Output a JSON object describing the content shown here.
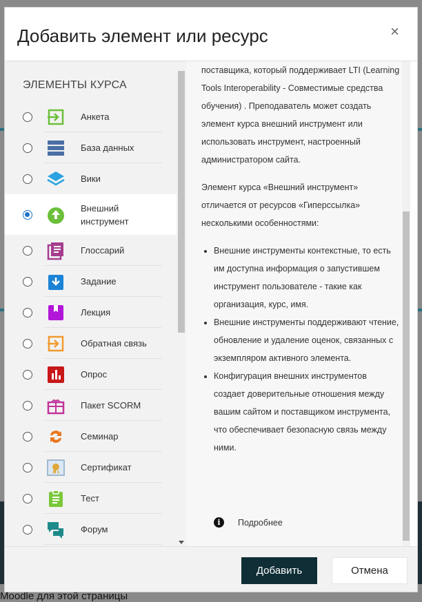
{
  "background": {
    "footer_text": "Moodle для этой страницы"
  },
  "modal": {
    "title": "Добавить элемент или ресурс",
    "close_symbol": "×",
    "section_heading": "ЭЛЕМЕНТЫ КУРСА",
    "items": [
      {
        "label": "Анкета",
        "icon": "feedback-arrow-icon",
        "color": "#6cbf3a",
        "selected": false
      },
      {
        "label": "База данных",
        "icon": "database-icon",
        "color": "#4a6fa5",
        "selected": false
      },
      {
        "label": "Вики",
        "icon": "wiki-layers-icon",
        "color": "#2ba3e0",
        "selected": false
      },
      {
        "label": "Внешний инструмент",
        "icon": "upload-cloud-icon",
        "color": "#6cbf3a",
        "selected": true
      },
      {
        "label": "Глоссарий",
        "icon": "glossary-icon",
        "color": "#a63d8f",
        "selected": false
      },
      {
        "label": "Задание",
        "icon": "assignment-icon",
        "color": "#1b83d6",
        "selected": false
      },
      {
        "label": "Лекция",
        "icon": "lesson-icon",
        "color": "#b117d8",
        "selected": false
      },
      {
        "label": "Обратная связь",
        "icon": "feedback-icon",
        "color": "#f29a2e",
        "selected": false
      },
      {
        "label": "Опрос",
        "icon": "choice-chart-icon",
        "color": "#c81818",
        "selected": false
      },
      {
        "label": "Пакет SCORM",
        "icon": "scorm-package-icon",
        "color": "#c2339a",
        "selected": false
      },
      {
        "label": "Семинар",
        "icon": "workshop-cycle-icon",
        "color": "#e9761d",
        "selected": false
      },
      {
        "label": "Сертификат",
        "icon": "certificate-icon",
        "color": "#e0a83a",
        "selected": false
      },
      {
        "label": "Тест",
        "icon": "quiz-icon",
        "color": "#7ac83a",
        "selected": false
      },
      {
        "label": "Форум",
        "icon": "forum-icon",
        "color": "#1f8a8a",
        "selected": false
      }
    ],
    "description": {
      "intro": "поставщика, который поддерживает LTI (Learning Tools Interoperability - Совместимые средства обучения) . Преподаватель может создать элемент курса внешний инструмент или использовать инструмент, настроенный администратором сайта.",
      "para2": "Элемент курса «Внешний инструмент» отличается от ресурсов «Гиперссылка» несколькими особенностями:",
      "bullets": [
        "Внешние инструменты контекстные, то есть им доступна информация о запустившем инструмент пользователе - такие как организация, курс, имя.",
        "Внешние инструменты поддерживают чтение, обновление и удаление оценок, связанных с экземпляром активного элемента.",
        "Конфигурация внешних инструментов создает доверительные отношения между вашим сайтом и поставщиком инструмента, что обеспечивает безопасную связь между ними."
      ],
      "more_link": "Подробнее"
    },
    "buttons": {
      "add": "Добавить",
      "cancel": "Отмена"
    }
  }
}
